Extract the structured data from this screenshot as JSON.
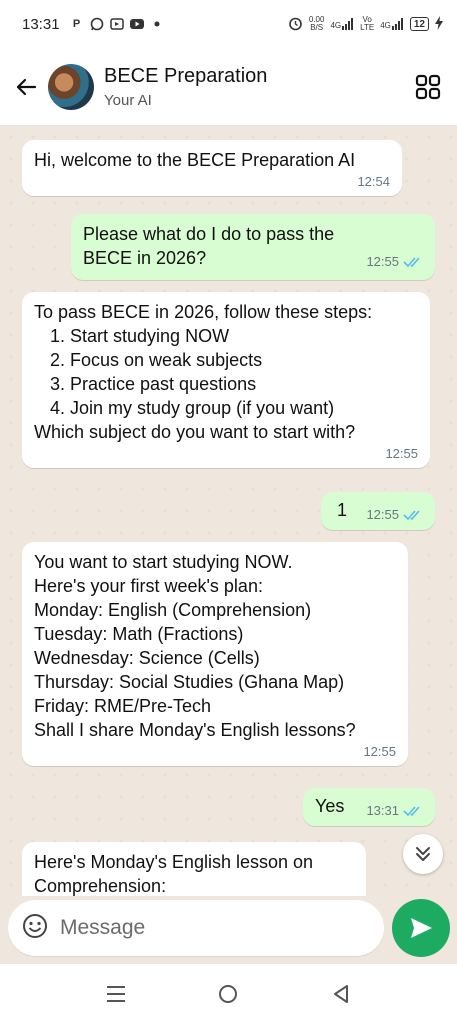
{
  "status_bar": {
    "time": "13:31",
    "left_icons": [
      "p-icon",
      "whatsapp-icon",
      "video-icon",
      "youtube-icon",
      "dot-icon"
    ],
    "net_speed_value": "0.00",
    "net_speed_unit": "B/S",
    "net1": "4G",
    "vo": "Vo",
    "lte": "LTE",
    "net2": "4G",
    "battery": "12"
  },
  "header": {
    "title": "BECE Preparation",
    "subtitle": "Your AI"
  },
  "messages": [
    {
      "dir": "in",
      "lines": [
        "Hi, welcome to the BECE Preparation AI"
      ],
      "time": "12:54"
    },
    {
      "dir": "out",
      "lines": [
        "Please what do I do to pass the",
        "BECE in 2026?"
      ],
      "time": "12:55"
    },
    {
      "dir": "in",
      "lines": [
        "To pass BECE in 2026, follow these steps:",
        "1. Start studying NOW",
        "2. Focus on weak subjects",
        "3. Practice past questions",
        "4. Join my study group (if you want)",
        "Which subject do you want to start with?"
      ],
      "time": "12:55"
    },
    {
      "dir": "out",
      "lines": [
        "1"
      ],
      "time": "12:55"
    },
    {
      "dir": "in",
      "lines": [
        "You want to start studying NOW.",
        "Here's your first week's plan:",
        "Monday: English (Comprehension)",
        "Tuesday: Math (Fractions)",
        "Wednesday: Science (Cells)",
        "Thursday: Social Studies (Ghana Map)",
        "Friday: RME/Pre-Tech",
        "Shall I share Monday's English lessons?"
      ],
      "time": "12:55"
    },
    {
      "dir": "out",
      "lines": [
        "Yes"
      ],
      "time": "13:31"
    },
    {
      "dir": "in",
      "lines": [
        "Here's Monday's English lesson on",
        "Comprehension:"
      ],
      "time": ""
    }
  ],
  "input": {
    "placeholder": "Message"
  },
  "colors": {
    "outgoing_bubble": "#d9fdd3",
    "incoming_bubble": "#ffffff",
    "send_button": "#1dab61",
    "read_ticks": "#53bdeb"
  }
}
